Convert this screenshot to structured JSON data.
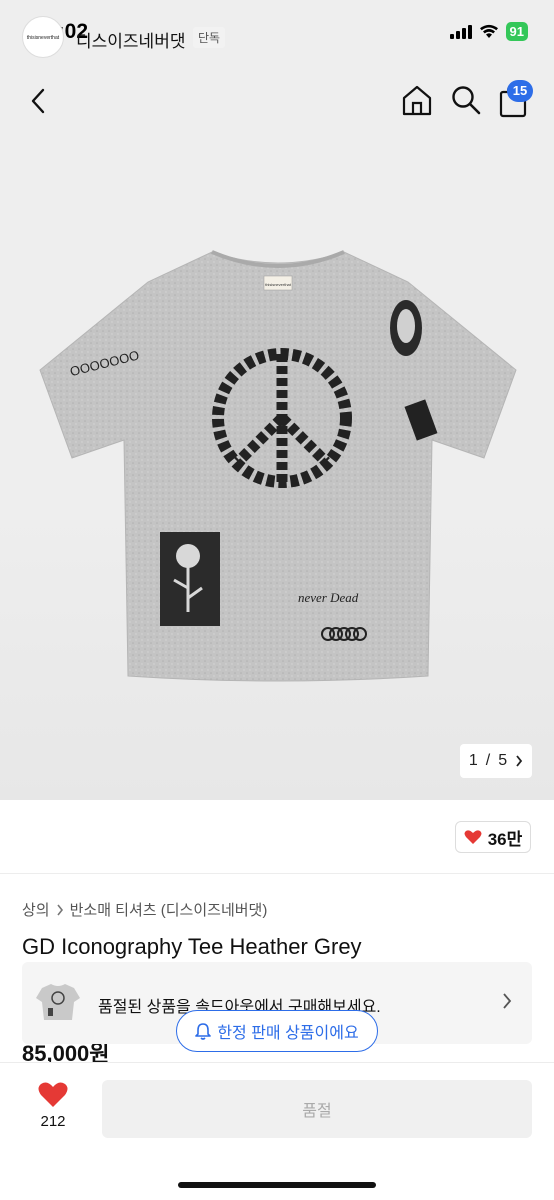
{
  "status": {
    "time": "5:02",
    "battery": "91"
  },
  "nav": {
    "cart_count": "15"
  },
  "gallery": {
    "current": "1",
    "separator": "/",
    "total": "5"
  },
  "tee_prints": {
    "neck_label": "thisisneverthat",
    "sleeve_text": "OOOOOOO",
    "sticker_text": "never Dead"
  },
  "brand": {
    "logo_text": "thisisneverthat",
    "name": "디스이즈네버댓",
    "tag": "단독"
  },
  "like": {
    "count": "36만"
  },
  "breadcrumb": {
    "root": "상의",
    "leaf": "반소매 티셔츠 (디스이즈네버댓)"
  },
  "product": {
    "title": "GD Iconography Tee Heather Grey",
    "price": "85,000원"
  },
  "soldout_banner": {
    "text": "품절된 상품을 솔드아웃에서 구매해보세요."
  },
  "limited_pill": {
    "text": "한정 판매 상품이에요"
  },
  "bottom": {
    "wish_count": "212",
    "buy_label": "품절"
  },
  "colors": {
    "accent": "#2d6de8",
    "heart": "#e53935",
    "battery": "#34c759"
  }
}
